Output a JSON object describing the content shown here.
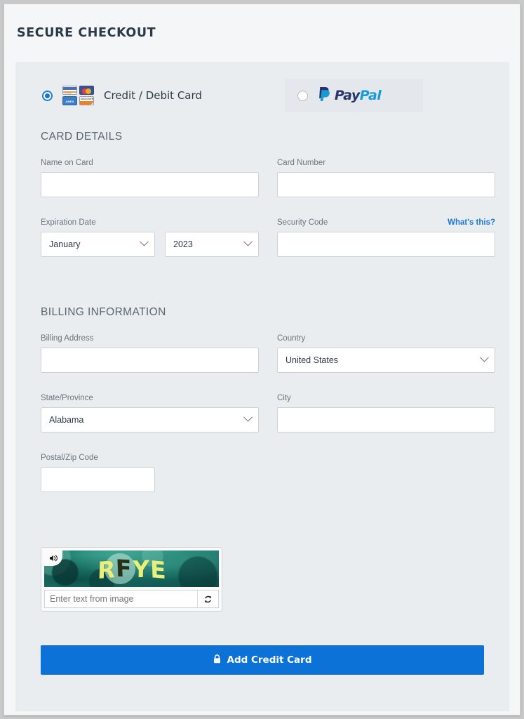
{
  "header": {
    "title": "SECURE CHECKOUT"
  },
  "payment_methods": {
    "credit_card": {
      "label": "Credit / Debit Card",
      "selected": true,
      "radio_name": "credit-card-radio",
      "card_brands": [
        "VISA",
        "Mastercard",
        "AMEX",
        "DISCOVER"
      ],
      "brand_short": {
        "visa": "VISA",
        "amex": "AMEX",
        "discover": "DISCOVER"
      }
    },
    "paypal": {
      "label": "PayPal",
      "logo_pay": "Pay",
      "logo_pal": "Pal",
      "selected": false
    }
  },
  "card_details": {
    "section_title": "CARD DETAILS",
    "name_on_card": {
      "label": "Name on Card",
      "value": "",
      "placeholder": ""
    },
    "card_number": {
      "label": "Card Number",
      "value": "",
      "placeholder": ""
    },
    "expiration": {
      "label": "Expiration Date",
      "month_value": "January",
      "year_value": "2023"
    },
    "security_code": {
      "label": "Security Code",
      "value": "",
      "help_link": "What's this?"
    }
  },
  "billing": {
    "section_title": "BILLING INFORMATION",
    "billing_address": {
      "label": "Billing Address",
      "value": ""
    },
    "country": {
      "label": "Country",
      "value": "United States"
    },
    "state": {
      "label": "State/Province",
      "value": "Alabama"
    },
    "city": {
      "label": "City",
      "value": ""
    },
    "postal": {
      "label": "Postal/Zip Code",
      "value": ""
    }
  },
  "captcha": {
    "challenge_text": "RFYE",
    "letters": [
      "R",
      "F",
      "Y",
      "E"
    ],
    "input_placeholder": "Enter text from image",
    "input_value": "",
    "audio_icon": "speaker-icon",
    "refresh_icon": "refresh-icon"
  },
  "submit": {
    "label": "Add Credit Card",
    "icon": "lock-icon",
    "color": "#0d72d7"
  },
  "colors": {
    "accent_blue": "#0d72d7",
    "link_blue": "#1a74d4",
    "panel_bg": "#e9edf0",
    "page_bg": "#f5f6f8"
  }
}
